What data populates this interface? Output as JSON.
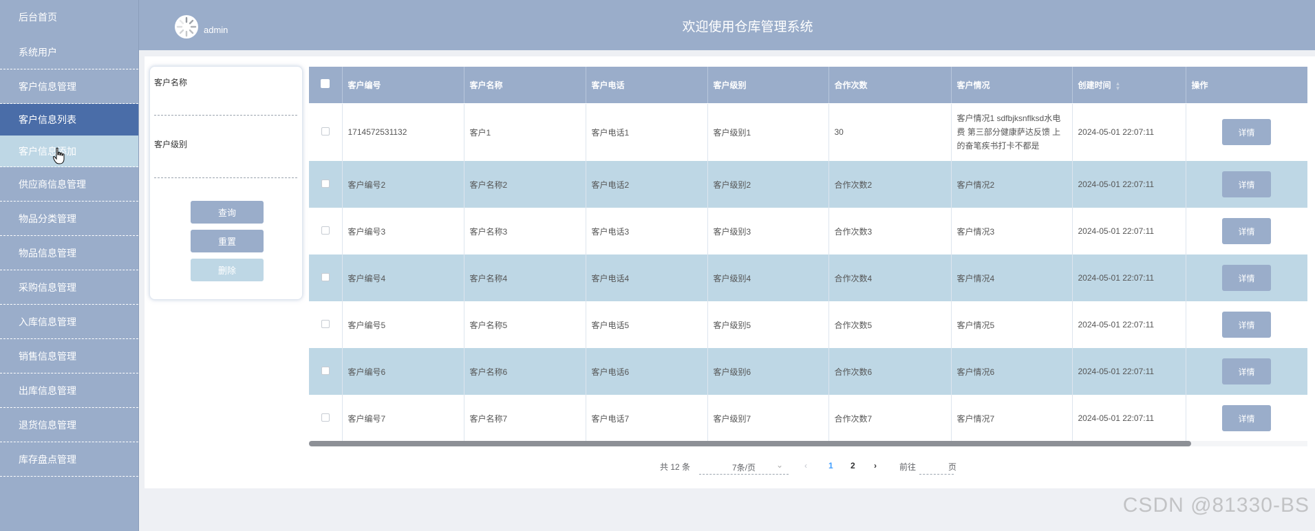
{
  "sidebar": {
    "items": [
      {
        "label": "后台首页"
      },
      {
        "label": "系统用户"
      },
      {
        "label": "客户信息管理"
      },
      {
        "label": "客户信息列表"
      },
      {
        "label": "客户信息添加"
      },
      {
        "label": "供应商信息管理"
      },
      {
        "label": "物品分类管理"
      },
      {
        "label": "物品信息管理"
      },
      {
        "label": "采购信息管理"
      },
      {
        "label": "入库信息管理"
      },
      {
        "label": "销售信息管理"
      },
      {
        "label": "出库信息管理"
      },
      {
        "label": "退货信息管理"
      },
      {
        "label": "库存盘点管理"
      }
    ]
  },
  "header": {
    "username": "admin",
    "title": "欢迎使用仓库管理系统"
  },
  "search": {
    "name_label": "客户名称",
    "name_value": "",
    "level_label": "客户级别",
    "level_value": "",
    "query_label": "查询",
    "reset_label": "重置",
    "delete_label": "删除"
  },
  "table": {
    "columns": [
      "客户编号",
      "客户名称",
      "客户电话",
      "客户级别",
      "合作次数",
      "客户情况",
      "创建时间",
      "操作"
    ],
    "detail_label": "详情",
    "rows": [
      {
        "id": "1714572531132",
        "name": "客户1",
        "phone": "客户电话1",
        "level": "客户级别1",
        "count": "30",
        "situation": "客户情况1 sdfbjksnflksd水电费 第三部分健康萨达反馈 上的奋笔疾书打卡不都是",
        "created": "2024-05-01 22:07:11"
      },
      {
        "id": "客户编号2",
        "name": "客户名称2",
        "phone": "客户电话2",
        "level": "客户级别2",
        "count": "合作次数2",
        "situation": "客户情况2",
        "created": "2024-05-01 22:07:11"
      },
      {
        "id": "客户编号3",
        "name": "客户名称3",
        "phone": "客户电话3",
        "level": "客户级别3",
        "count": "合作次数3",
        "situation": "客户情况3",
        "created": "2024-05-01 22:07:11"
      },
      {
        "id": "客户编号4",
        "name": "客户名称4",
        "phone": "客户电话4",
        "level": "客户级别4",
        "count": "合作次数4",
        "situation": "客户情况4",
        "created": "2024-05-01 22:07:11"
      },
      {
        "id": "客户编号5",
        "name": "客户名称5",
        "phone": "客户电话5",
        "level": "客户级别5",
        "count": "合作次数5",
        "situation": "客户情况5",
        "created": "2024-05-01 22:07:11"
      },
      {
        "id": "客户编号6",
        "name": "客户名称6",
        "phone": "客户电话6",
        "level": "客户级别6",
        "count": "合作次数6",
        "situation": "客户情况6",
        "created": "2024-05-01 22:07:11"
      },
      {
        "id": "客户编号7",
        "name": "客户名称7",
        "phone": "客户电话7",
        "level": "客户级别7",
        "count": "合作次数7",
        "situation": "客户情况7",
        "created": "2024-05-01 22:07:11"
      }
    ]
  },
  "pagination": {
    "total": "共 12 条",
    "page_size": "7条/页",
    "prev_icon": "chevron-left-icon",
    "page_1": "1",
    "page_2": "2",
    "next_icon": "chevron-right-icon",
    "goto_label": "前往",
    "page_suffix": "页",
    "active_color": "#409eff"
  },
  "watermark": "CSDN @81330-BS",
  "colors": {
    "primary": "#9aadca",
    "active": "#4a6da8",
    "light": "#bed7e5"
  }
}
